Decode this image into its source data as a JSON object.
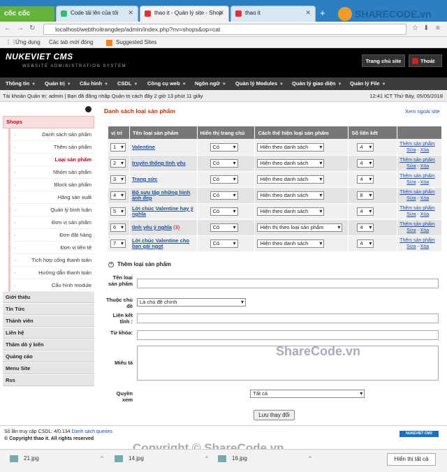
{
  "browser": {
    "brand": "cốc cốc",
    "tabs": [
      "Code tải lên của tôi",
      "thao it - Quản lý site - Shop",
      "thao it"
    ],
    "url": "localhost/webthoitrangdep/admin/index.php?nv=shops&op=cat",
    "bookmarks": [
      "Ứng dụng",
      "Các tab mới đóng",
      "Suggested Sites"
    ],
    "sharecode_logo": "SHARECODE.vn"
  },
  "header": {
    "logo": "NUKEVIET CMS",
    "logo_sub": "WEBSITE ADMINISTRATION SYSTEM",
    "home_label": "Trang chủ site",
    "logout_label": "Thoát"
  },
  "menu": [
    "Thông tin",
    "Quản trị",
    "Cấu hình",
    "CSDL",
    "Công cụ web",
    "Ngôn ngữ",
    "Quản lý Modules",
    "Quản lý giao diện",
    "Quản lý File"
  ],
  "infobar": {
    "text": "Tài khoản Quản trị: admin | Bạn đã đăng nhập Quản trị cách đây 2 giờ 13 phút 11 giây",
    "time": "12:41 ICT   Thứ Bảy, 05/05/2018"
  },
  "sidebar": {
    "section": "Shops",
    "items": [
      "Danh sách sản phẩm",
      "Thêm sản phẩm",
      "Loại sản phẩm",
      "Nhóm sản phẩm",
      "Block sản phẩm",
      "Hãng sản xuất",
      "Quản lý bình luận",
      "Đơn vị sản phẩm",
      "Đơn đặt hàng",
      "Đơn vị tiền tệ",
      "Tích hợp cổng thanh toán",
      "Hướng dẫn thanh toán",
      "Cấu hình module"
    ],
    "sections": [
      "Giới thiệu",
      "Tin Tức",
      "Thành viên",
      "Liên hệ",
      "Thăm dò ý kiến",
      "Quảng cáo",
      "Menu Site",
      "Rss"
    ]
  },
  "main": {
    "title": "Danh sách loại sản phẩm",
    "outside_link": "Xem ngoài site",
    "columns": [
      "vị trí",
      "Tên loại sản phẩm",
      "Hiển thị trang chủ",
      "Cách thể hiện loại sản phẩm",
      "Số liên kết"
    ],
    "rows": [
      {
        "pos": "1",
        "name": "Valentine",
        "count": "",
        "home": "Có",
        "view": "Hiện theo danh sách",
        "links": "4"
      },
      {
        "pos": "2",
        "name": "truyền thống tình yêu",
        "count": "",
        "home": "Có",
        "view": "Hiện theo danh sách",
        "links": "4"
      },
      {
        "pos": "3",
        "name": "Trang sức",
        "count": "",
        "home": "Có",
        "view": "Hiện theo danh sách",
        "links": "4"
      },
      {
        "pos": "4",
        "name": "Bộ sưu tập những hình ảnh đẹp",
        "count": "",
        "home": "Có",
        "view": "Hiện theo danh sách",
        "links": "8"
      },
      {
        "pos": "5",
        "name": "Lời chúc Valentine hay ý nghĩa",
        "count": "",
        "home": "Có",
        "view": "Hiện theo danh sách",
        "links": "4"
      },
      {
        "pos": "6",
        "name": "tình yêu ý nghĩa",
        "count": "(3)",
        "home": "Có",
        "view": "Hiện thị theo loại sản phẩm",
        "links": "4"
      },
      {
        "pos": "7",
        "name": "Lời chúc Valentine cho bạn gái ngọt",
        "count": "",
        "home": "Có",
        "view": "Hiện theo danh sách",
        "links": "4"
      }
    ],
    "actions": {
      "add": "Thêm sản phẩm",
      "edit": "Sửa",
      "delete": "Xóa"
    }
  },
  "form": {
    "title": "Thêm loại sản phẩm",
    "name_label": "Tên loại sản phẩm",
    "parent_label": "Thuộc chủ đề",
    "parent_value": "Là chủ đề chính",
    "link_label": "Liên kết tĩnh :",
    "keyword_label": "Từ khóa:",
    "desc_label": "Miêu tả",
    "perm_label": "Quyền xem",
    "perm_value": "Tất cả",
    "save_label": "Lưu thay đổi"
  },
  "footer": {
    "queries": "Số lần truy cập CSDL: 4/0.134",
    "queries_link": "Danh sách queries",
    "copyright": "© Copyright thao it. All rights reserved",
    "logo": "NUKEVIET CMS"
  },
  "watermark": "Copyright © ShareCode.vn",
  "watermark2": "ShareCode.vn",
  "downloads": [
    "21.jpg",
    "14.jpg",
    "16.jpg"
  ],
  "show_all": "Hiển thị tất cả"
}
